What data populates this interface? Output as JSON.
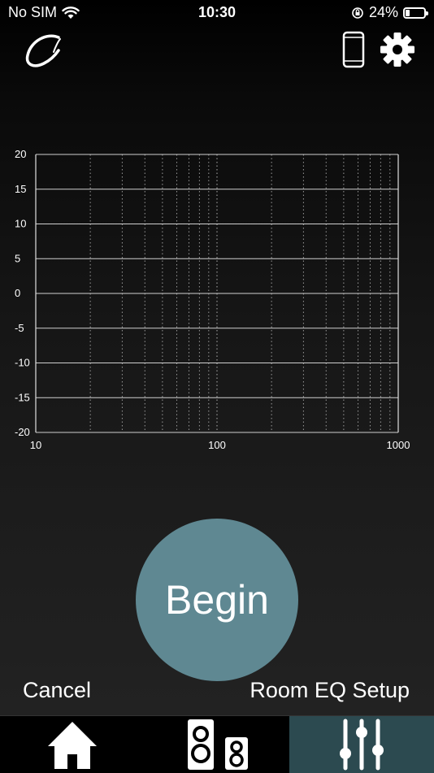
{
  "status_bar": {
    "carrier": "No SIM",
    "time": "10:30",
    "battery": "24%",
    "battery_level": 0.24
  },
  "header": {
    "logo_icon": "script-c-logo-icon",
    "device_icon": "phone-device-icon",
    "settings_icon": "gear-icon"
  },
  "graph": {
    "y_ticks": [
      "20",
      "15",
      "10",
      "5",
      "0",
      "-5",
      "-10",
      "-15",
      "-20"
    ],
    "x_ticks": [
      "10",
      "100",
      "1000"
    ]
  },
  "chart_data": {
    "type": "line",
    "series": [],
    "x_scale": "log",
    "xlim": [
      10,
      1000
    ],
    "ylim": [
      -20,
      20
    ],
    "y_ticks": [
      20,
      15,
      10,
      5,
      0,
      -5,
      -10,
      -15,
      -20
    ],
    "x_ticks": [
      10,
      100,
      1000
    ],
    "grid": true
  },
  "actions": {
    "begin_label": "Begin",
    "cancel_label": "Cancel",
    "screen_title": "Room EQ Setup"
  },
  "tab_bar": {
    "tabs": [
      {
        "icon": "home-icon",
        "active": false
      },
      {
        "icon": "speakers-icon",
        "active": false
      },
      {
        "icon": "eq-sliders-icon",
        "active": true
      }
    ],
    "active_color": "#2c4a50"
  },
  "colors": {
    "accent": "#5f8892",
    "background": "#000000"
  }
}
